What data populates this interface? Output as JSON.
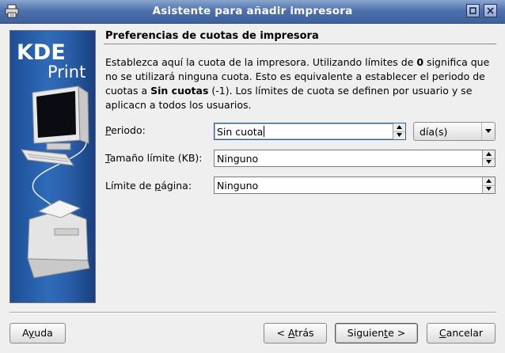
{
  "window": {
    "title": "Asistente para añadir impresora"
  },
  "sidebar": {
    "logo_kde": "KDE",
    "logo_print": "Print"
  },
  "page": {
    "section_title": "Preferencias de cuotas de impresora",
    "description": {
      "p1": "Establezca aquí la cuota de la impresora. Utilizando límites de ",
      "bold1": "0",
      "p2": " significa que no se utilizará ninguna cuota. Esto es equivalente a establecer el periodo de cuotas a ",
      "bold2": "Sin cuotas",
      "p3": " (-1). Los límites de cuota se definen por usuario y se aplicacn a todos los usuarios."
    }
  },
  "form": {
    "period": {
      "label_mnemonic": "P",
      "label_rest": "eriodo:",
      "value": "Sin cuota",
      "unit": "día(s)"
    },
    "size_limit": {
      "label_mnemonic": "T",
      "label_rest": "amaño límite (KB):",
      "value": "Ninguno"
    },
    "page_limit": {
      "label_pre": "Límite de ",
      "label_mnemonic": "p",
      "label_rest": "ágina:",
      "value": "Ninguno"
    }
  },
  "buttons": {
    "help": {
      "pre": "A",
      "mnemonic": "y",
      "rest": "uda"
    },
    "back": {
      "pre": "< ",
      "mnemonic": "A",
      "rest": "trás"
    },
    "next": {
      "pre": "Siguien",
      "mnemonic": "t",
      "rest": "e >"
    },
    "cancel": {
      "pre": "",
      "mnemonic": "C",
      "rest": "ancelar"
    }
  },
  "colors": {
    "titlebar": "#4f72ad",
    "sidebar": "#2f6bb8"
  },
  "icons": {
    "app": "printer-icon",
    "minimize": "minimize-icon",
    "close": "close-icon"
  }
}
